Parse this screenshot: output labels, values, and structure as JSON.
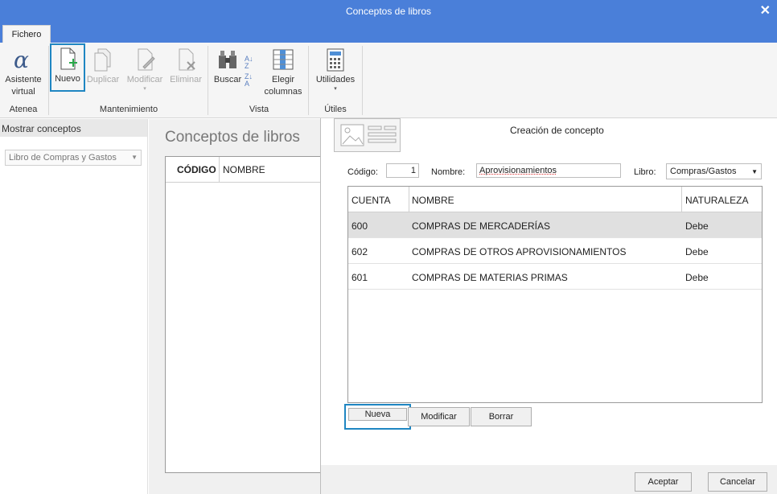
{
  "window": {
    "title": "Conceptos de libros",
    "close_glyph": "✕"
  },
  "tabs": [
    {
      "label": "Fichero"
    }
  ],
  "ribbon": {
    "buttons": {
      "asistente": "Asistente virtual",
      "nuevo": "Nuevo",
      "duplicar": "Duplicar",
      "modificar": "Modificar",
      "eliminar": "Eliminar",
      "buscar": "Buscar",
      "elegir": "Elegir columnas",
      "utilidades": "Utilidades"
    },
    "groups": {
      "atenea": "Atenea",
      "mantenimiento": "Mantenimiento",
      "vista": "Vista",
      "utiles": "Útiles"
    }
  },
  "left": {
    "header": "Mostrar conceptos",
    "combo_value": "Libro de Compras y Gastos"
  },
  "center": {
    "heading": "Conceptos de libros",
    "columns": [
      "CÓDIGO",
      "NOMBRE"
    ]
  },
  "dialog": {
    "title": "Creación de concepto",
    "codigo_label": "Código:",
    "codigo_value": "1",
    "nombre_label": "Nombre:",
    "nombre_value": "Aprovisionamientos",
    "libro_label": "Libro:",
    "libro_value": "Compras/Gastos",
    "columns": [
      "CUENTA",
      "NOMBRE",
      "NATURALEZA"
    ],
    "rows": [
      {
        "cuenta": "600",
        "nombre": "COMPRAS DE MERCADERÍAS",
        "naturaleza": "Debe"
      },
      {
        "cuenta": "602",
        "nombre": "COMPRAS DE OTROS APROVISIONAMIENTOS",
        "naturaleza": "Debe"
      },
      {
        "cuenta": "601",
        "nombre": "COMPRAS DE MATERIAS PRIMAS",
        "naturaleza": "Debe"
      }
    ],
    "buttons": {
      "nueva": "Nueva",
      "modificar": "Modificar",
      "borrar": "Borrar"
    },
    "footer": {
      "aceptar": "Aceptar",
      "cancelar": "Cancelar"
    }
  },
  "colors": {
    "titlebar": "#4a7fd9",
    "focus": "#1f86c2",
    "add_green": "#2aa84a"
  }
}
